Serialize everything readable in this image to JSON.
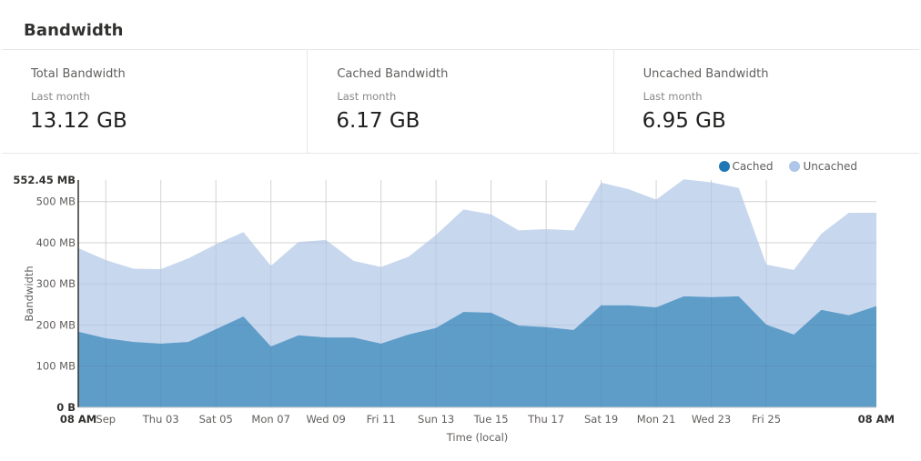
{
  "page": {
    "title": "Bandwidth"
  },
  "cards": [
    {
      "label": "Total Bandwidth",
      "period": "Last month",
      "value": "13.12 GB"
    },
    {
      "label": "Cached Bandwidth",
      "period": "Last month",
      "value": "6.17 GB"
    },
    {
      "label": "Uncached Bandwidth",
      "period": "Last month",
      "value": "6.95 GB"
    }
  ],
  "colors": {
    "cached": "#1f77b4",
    "uncached": "#aec7e8",
    "cached_fill": "#5f9dc9",
    "uncached_fill": "#c7d7ee"
  },
  "chart_data": {
    "type": "area",
    "stacked": true,
    "title": "",
    "xlabel": "Time (local)",
    "ylabel": "Bandwidth",
    "ylim": [
      0,
      552.45
    ],
    "y_unit": "MB",
    "y_ticks": [
      {
        "value": 0,
        "label": "0 B",
        "bold": true
      },
      {
        "value": 100,
        "label": "100 MB"
      },
      {
        "value": 200,
        "label": "200 MB"
      },
      {
        "value": 300,
        "label": "300 MB"
      },
      {
        "value": 400,
        "label": "400 MB"
      },
      {
        "value": 500,
        "label": "500 MB"
      },
      {
        "value": 552.45,
        "label": "552.45 MB",
        "bold": true
      }
    ],
    "x_ticks": [
      {
        "index": 0,
        "label": "08 AM",
        "bold": true
      },
      {
        "index": 1,
        "label": "Sep"
      },
      {
        "index": 3,
        "label": "Thu 03"
      },
      {
        "index": 5,
        "label": "Sat 05"
      },
      {
        "index": 7,
        "label": "Mon 07"
      },
      {
        "index": 9,
        "label": "Wed 09"
      },
      {
        "index": 11,
        "label": "Fri 11"
      },
      {
        "index": 13,
        "label": "Sun 13"
      },
      {
        "index": 15,
        "label": "Tue 15"
      },
      {
        "index": 17,
        "label": "Thu 17"
      },
      {
        "index": 19,
        "label": "Sat 19"
      },
      {
        "index": 21,
        "label": "Mon 21"
      },
      {
        "index": 23,
        "label": "Wed 23"
      },
      {
        "index": 25,
        "label": "Fri 25"
      },
      {
        "index": 29,
        "label": "08 AM",
        "bold": true
      }
    ],
    "grid": true,
    "legend": {
      "position": "top-right",
      "entries": [
        "Cached",
        "Uncached"
      ]
    },
    "series": [
      {
        "name": "Cached",
        "values": [
          184,
          168,
          159,
          155,
          159,
          190,
          221,
          148,
          175,
          170,
          170,
          155,
          177,
          193,
          232,
          230,
          199,
          195,
          188,
          248,
          248,
          243,
          270,
          268,
          270,
          201,
          177,
          237,
          224,
          246
        ]
      },
      {
        "name": "Uncached",
        "values": [
          203,
          190,
          178,
          181,
          203,
          206,
          205,
          196,
          227,
          237,
          186,
          186,
          189,
          226,
          249,
          239,
          231,
          238,
          242,
          298,
          282,
          262,
          284,
          279,
          263,
          146,
          157,
          185,
          249,
          227
        ]
      }
    ]
  }
}
